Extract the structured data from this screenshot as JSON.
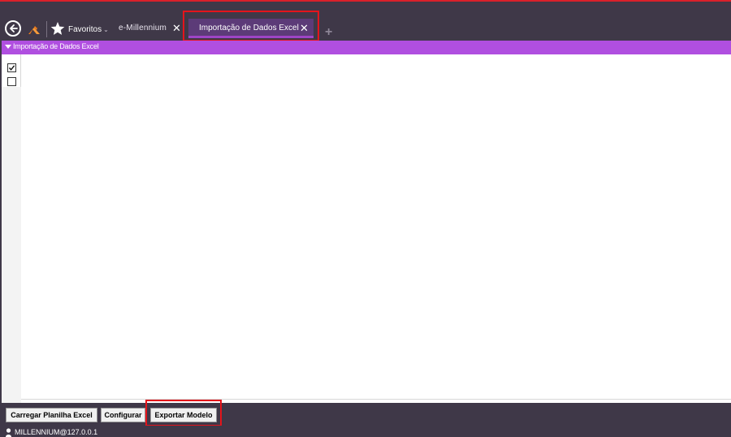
{
  "colors": {
    "background": "#3f3848",
    "accent": "#b04fe0",
    "active_tab": "#5c3b78",
    "highlight_frame": "#e4141b"
  },
  "icons": {
    "back": "back-arrow-circle-icon",
    "logo": "millennium-logo-icon",
    "favorites": "star-icon",
    "close": "close-icon",
    "add_tab": "plus-icon",
    "collapse": "triangle-down-icon",
    "user": "user-icon"
  },
  "header": {
    "favorites_label": "Favoritos",
    "favorites_caret": "⌄",
    "tabs": [
      {
        "label": "e-Millennium",
        "active": false,
        "close": "✕"
      },
      {
        "label": "Importação de Dados Excel",
        "active": true,
        "close": "✕"
      }
    ],
    "add_tab": "+"
  },
  "panel": {
    "title": "Importação de Dados Excel",
    "rows": [
      {
        "checked": true
      },
      {
        "checked": false
      }
    ]
  },
  "toolbar": {
    "load_label": "Carregar Planilha Excel",
    "configure_label": "Configurar",
    "export_label": "Exportar Modelo"
  },
  "status": {
    "connection": "MILLENNIUM@127.0.0.1"
  }
}
